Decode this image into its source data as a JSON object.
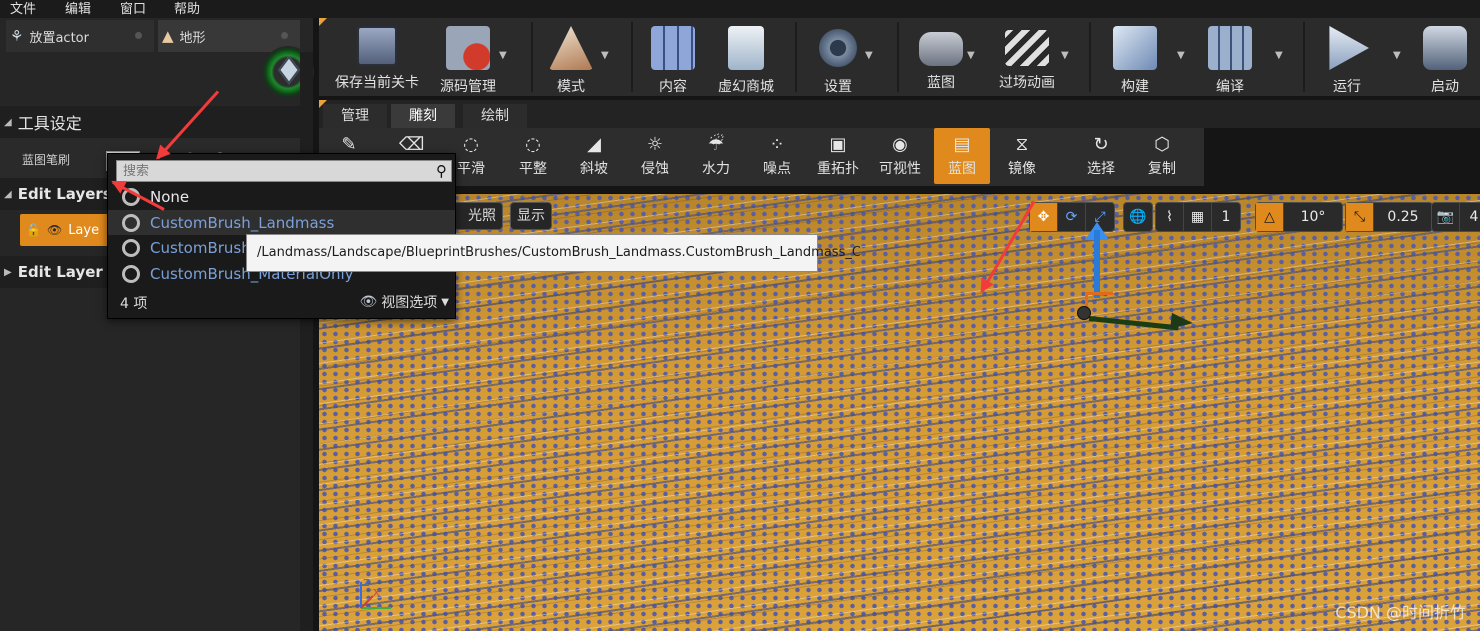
{
  "menu": [
    "文件",
    "编辑",
    "窗口",
    "帮助"
  ],
  "mode_tabs": [
    {
      "label": "放置actor"
    },
    {
      "label": "地形"
    }
  ],
  "left_panel": {
    "tool_settings_title": "工具设定",
    "brush_label": "蓝图笔刷",
    "brush_value": "N",
    "edit_layers_title": "Edit Layers",
    "layer_item": "Laye",
    "edit_layer_blueprint_title": "Edit Layer B"
  },
  "toolbar": [
    {
      "label": "保存当前关卡",
      "icon": "save-icon"
    },
    {
      "label": "源码管理",
      "icon": "source-control-icon"
    },
    {
      "label": "模式",
      "icon": "modes-icon"
    },
    {
      "label": "内容",
      "icon": "content-icon"
    },
    {
      "label": "虚幻商城",
      "icon": "marketplace-icon"
    },
    {
      "label": "设置",
      "icon": "settings-icon"
    },
    {
      "label": "蓝图",
      "icon": "blueprint-icon"
    },
    {
      "label": "过场动画",
      "icon": "cinematics-icon"
    },
    {
      "label": "构建",
      "icon": "build-icon"
    },
    {
      "label": "编译",
      "icon": "compile-icon"
    },
    {
      "label": "运行",
      "icon": "play-icon"
    },
    {
      "label": "启动",
      "icon": "launch-icon"
    }
  ],
  "sub_tabs": [
    "管理",
    "雕刻",
    "绘制"
  ],
  "sculpt_tools": [
    {
      "label": "",
      "icon": "sculpt-icon"
    },
    {
      "label": "",
      "icon": "erase-icon"
    },
    {
      "label": "平滑",
      "icon": "smooth-icon"
    },
    {
      "label": "平整",
      "icon": "flatten-icon"
    },
    {
      "label": "斜坡",
      "icon": "ramp-icon"
    },
    {
      "label": "侵蚀",
      "icon": "erosion-icon"
    },
    {
      "label": "水力",
      "icon": "hydro-icon"
    },
    {
      "label": "噪点",
      "icon": "noise-icon"
    },
    {
      "label": "重拓扑",
      "icon": "retopologize-icon"
    },
    {
      "label": "可视性",
      "icon": "visibility-icon"
    },
    {
      "label": "蓝图",
      "icon": "blueprint-brush-icon"
    },
    {
      "label": "镜像",
      "icon": "mirror-icon"
    },
    {
      "label": "选择",
      "icon": "select-icon"
    },
    {
      "label": "复制",
      "icon": "copy-icon"
    }
  ],
  "viewport": {
    "lit_label": "光照",
    "show_label": "显示",
    "grid_value": "1",
    "rotation_value": "10°",
    "scale_value": "0.25",
    "camera_speed": "4",
    "watermark": "CSDN @时间折竹"
  },
  "dropdown": {
    "search_placeholder": "搜索",
    "items": [
      "None",
      "CustomBrush_Landmass",
      "CustomBrush",
      "CustomBrush_MaterialOnly"
    ],
    "count_label": "4 项",
    "view_options_label": "视图选项",
    "tooltip": "/Landmass/Landscape/BlueprintBrushes/CustomBrush_Landmass.CustomBrush_Landmass_C"
  },
  "colors": {
    "accent_orange": "#e08a1e",
    "annotation_arrow": "#f23b3b",
    "asset_link": "#7aa0d8"
  }
}
